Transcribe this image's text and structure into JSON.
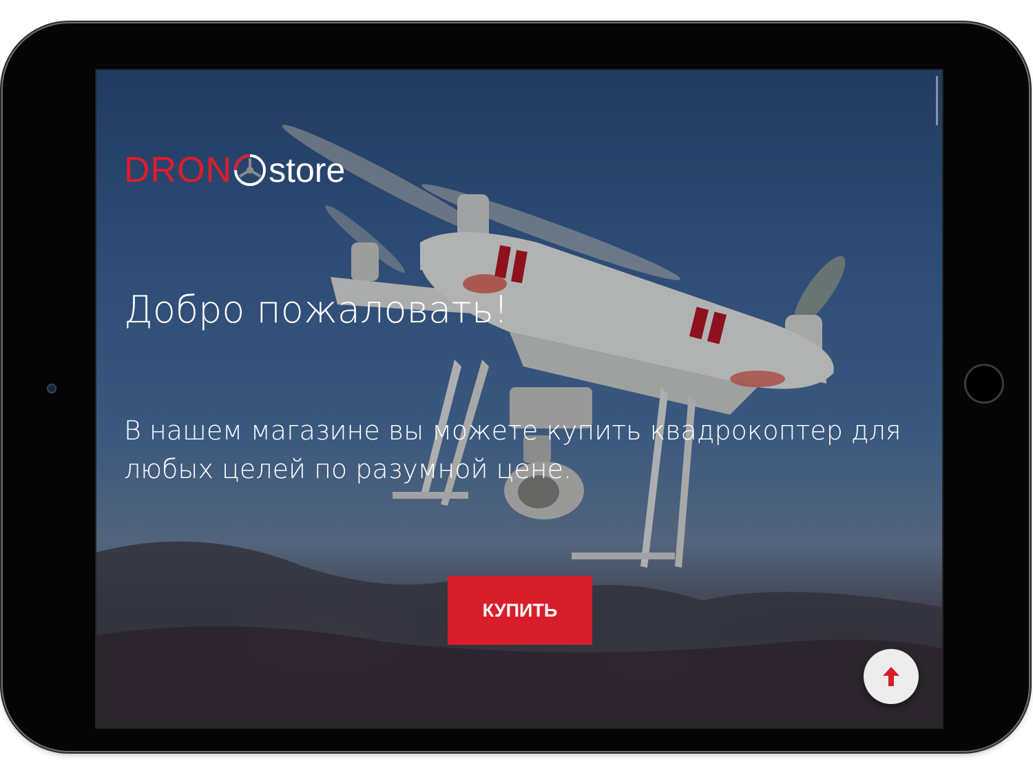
{
  "app": {
    "logo": {
      "part1": "DRON",
      "part2": "store"
    },
    "hero": {
      "heading": "Добро пожаловать!",
      "description": "В нашем магазине вы можете купить квадрокоптер для любых целей по разумной цене.",
      "buy_button_label": "КУПИТЬ"
    },
    "icons": {
      "logo_mark": "drone-rotor-icon",
      "scroll_top": "arrow-up-icon"
    }
  },
  "colors": {
    "brand_red": "#d71e2a",
    "logo_red": "#e01b2c",
    "text": "#ffffff",
    "device": "#050505"
  }
}
